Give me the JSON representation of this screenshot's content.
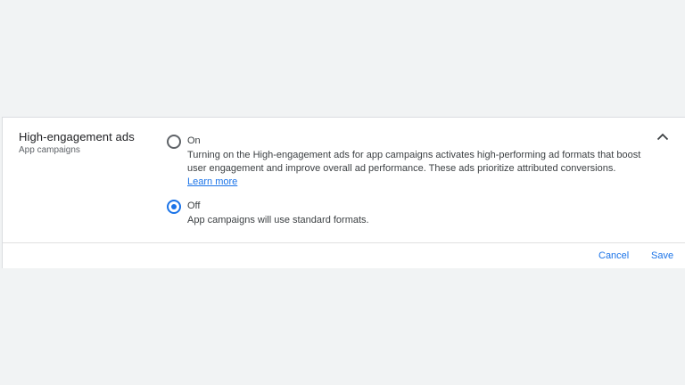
{
  "section": {
    "title": "High-engagement ads",
    "subtitle": "App campaigns"
  },
  "options": [
    {
      "label": "On",
      "checked": false,
      "description": "Turning on the High-engagement ads for app campaigns activates high-performing ad formats that boost user engagement and improve overall ad performance. These ads prioritize attributed conversions.",
      "link_text": "Learn more"
    },
    {
      "label": "Off",
      "checked": true,
      "description": "App campaigns will use standard formats."
    }
  ],
  "actions": {
    "cancel_label": "Cancel",
    "save_label": "Save"
  },
  "icons": {
    "collapse": "chevron-up-icon"
  },
  "colors": {
    "accent": "#1a73e8",
    "background": "#f1f3f4"
  }
}
